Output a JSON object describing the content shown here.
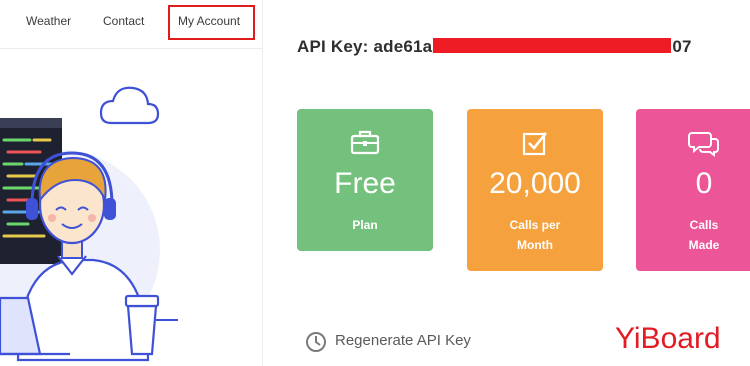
{
  "nav": {
    "items": [
      {
        "label": "Weather"
      },
      {
        "label": "Contact"
      },
      {
        "label": "My Account"
      }
    ]
  },
  "account": {
    "api_key_label": "API Key:",
    "api_key_prefix": "ade61a",
    "api_key_suffix": "07"
  },
  "cards": [
    {
      "value": "Free",
      "label_line1": "Plan",
      "label_line2": "",
      "color": "#74c17e",
      "icon": "briefcase-icon"
    },
    {
      "value": "20,000",
      "label_line1": "Calls per",
      "label_line2": "Month",
      "color": "#f5a13d",
      "icon": "checkbox-icon"
    },
    {
      "value": "0",
      "label_line1": "Calls",
      "label_line2": "Made",
      "color": "#ec5597",
      "icon": "chat-bubbles-icon"
    }
  ],
  "regenerate": {
    "label": "Regenerate API Key",
    "icon": "clock-icon"
  },
  "watermark": {
    "text": "YiBoard",
    "color": "#e31b23"
  },
  "colors": {
    "highlight_box": "#e01b1b",
    "redaction": "#ee1c25"
  }
}
